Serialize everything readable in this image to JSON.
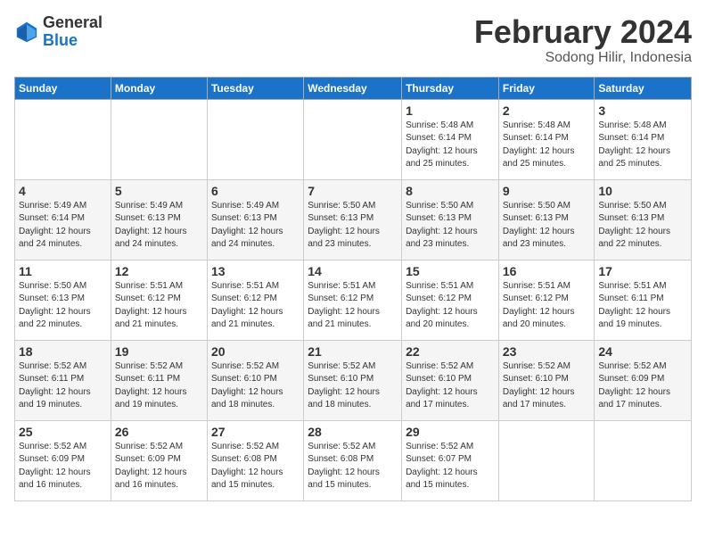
{
  "logo": {
    "general": "General",
    "blue": "Blue"
  },
  "title": "February 2024",
  "location": "Sodong Hilir, Indonesia",
  "headers": [
    "Sunday",
    "Monday",
    "Tuesday",
    "Wednesday",
    "Thursday",
    "Friday",
    "Saturday"
  ],
  "weeks": [
    [
      {
        "day": "",
        "info": ""
      },
      {
        "day": "",
        "info": ""
      },
      {
        "day": "",
        "info": ""
      },
      {
        "day": "",
        "info": ""
      },
      {
        "day": "1",
        "info": "Sunrise: 5:48 AM\nSunset: 6:14 PM\nDaylight: 12 hours\nand 25 minutes."
      },
      {
        "day": "2",
        "info": "Sunrise: 5:48 AM\nSunset: 6:14 PM\nDaylight: 12 hours\nand 25 minutes."
      },
      {
        "day": "3",
        "info": "Sunrise: 5:48 AM\nSunset: 6:14 PM\nDaylight: 12 hours\nand 25 minutes."
      }
    ],
    [
      {
        "day": "4",
        "info": "Sunrise: 5:49 AM\nSunset: 6:14 PM\nDaylight: 12 hours\nand 24 minutes."
      },
      {
        "day": "5",
        "info": "Sunrise: 5:49 AM\nSunset: 6:13 PM\nDaylight: 12 hours\nand 24 minutes."
      },
      {
        "day": "6",
        "info": "Sunrise: 5:49 AM\nSunset: 6:13 PM\nDaylight: 12 hours\nand 24 minutes."
      },
      {
        "day": "7",
        "info": "Sunrise: 5:50 AM\nSunset: 6:13 PM\nDaylight: 12 hours\nand 23 minutes."
      },
      {
        "day": "8",
        "info": "Sunrise: 5:50 AM\nSunset: 6:13 PM\nDaylight: 12 hours\nand 23 minutes."
      },
      {
        "day": "9",
        "info": "Sunrise: 5:50 AM\nSunset: 6:13 PM\nDaylight: 12 hours\nand 23 minutes."
      },
      {
        "day": "10",
        "info": "Sunrise: 5:50 AM\nSunset: 6:13 PM\nDaylight: 12 hours\nand 22 minutes."
      }
    ],
    [
      {
        "day": "11",
        "info": "Sunrise: 5:50 AM\nSunset: 6:13 PM\nDaylight: 12 hours\nand 22 minutes."
      },
      {
        "day": "12",
        "info": "Sunrise: 5:51 AM\nSunset: 6:12 PM\nDaylight: 12 hours\nand 21 minutes."
      },
      {
        "day": "13",
        "info": "Sunrise: 5:51 AM\nSunset: 6:12 PM\nDaylight: 12 hours\nand 21 minutes."
      },
      {
        "day": "14",
        "info": "Sunrise: 5:51 AM\nSunset: 6:12 PM\nDaylight: 12 hours\nand 21 minutes."
      },
      {
        "day": "15",
        "info": "Sunrise: 5:51 AM\nSunset: 6:12 PM\nDaylight: 12 hours\nand 20 minutes."
      },
      {
        "day": "16",
        "info": "Sunrise: 5:51 AM\nSunset: 6:12 PM\nDaylight: 12 hours\nand 20 minutes."
      },
      {
        "day": "17",
        "info": "Sunrise: 5:51 AM\nSunset: 6:11 PM\nDaylight: 12 hours\nand 19 minutes."
      }
    ],
    [
      {
        "day": "18",
        "info": "Sunrise: 5:52 AM\nSunset: 6:11 PM\nDaylight: 12 hours\nand 19 minutes."
      },
      {
        "day": "19",
        "info": "Sunrise: 5:52 AM\nSunset: 6:11 PM\nDaylight: 12 hours\nand 19 minutes."
      },
      {
        "day": "20",
        "info": "Sunrise: 5:52 AM\nSunset: 6:10 PM\nDaylight: 12 hours\nand 18 minutes."
      },
      {
        "day": "21",
        "info": "Sunrise: 5:52 AM\nSunset: 6:10 PM\nDaylight: 12 hours\nand 18 minutes."
      },
      {
        "day": "22",
        "info": "Sunrise: 5:52 AM\nSunset: 6:10 PM\nDaylight: 12 hours\nand 17 minutes."
      },
      {
        "day": "23",
        "info": "Sunrise: 5:52 AM\nSunset: 6:10 PM\nDaylight: 12 hours\nand 17 minutes."
      },
      {
        "day": "24",
        "info": "Sunrise: 5:52 AM\nSunset: 6:09 PM\nDaylight: 12 hours\nand 17 minutes."
      }
    ],
    [
      {
        "day": "25",
        "info": "Sunrise: 5:52 AM\nSunset: 6:09 PM\nDaylight: 12 hours\nand 16 minutes."
      },
      {
        "day": "26",
        "info": "Sunrise: 5:52 AM\nSunset: 6:09 PM\nDaylight: 12 hours\nand 16 minutes."
      },
      {
        "day": "27",
        "info": "Sunrise: 5:52 AM\nSunset: 6:08 PM\nDaylight: 12 hours\nand 15 minutes."
      },
      {
        "day": "28",
        "info": "Sunrise: 5:52 AM\nSunset: 6:08 PM\nDaylight: 12 hours\nand 15 minutes."
      },
      {
        "day": "29",
        "info": "Sunrise: 5:52 AM\nSunset: 6:07 PM\nDaylight: 12 hours\nand 15 minutes."
      },
      {
        "day": "",
        "info": ""
      },
      {
        "day": "",
        "info": ""
      }
    ]
  ]
}
